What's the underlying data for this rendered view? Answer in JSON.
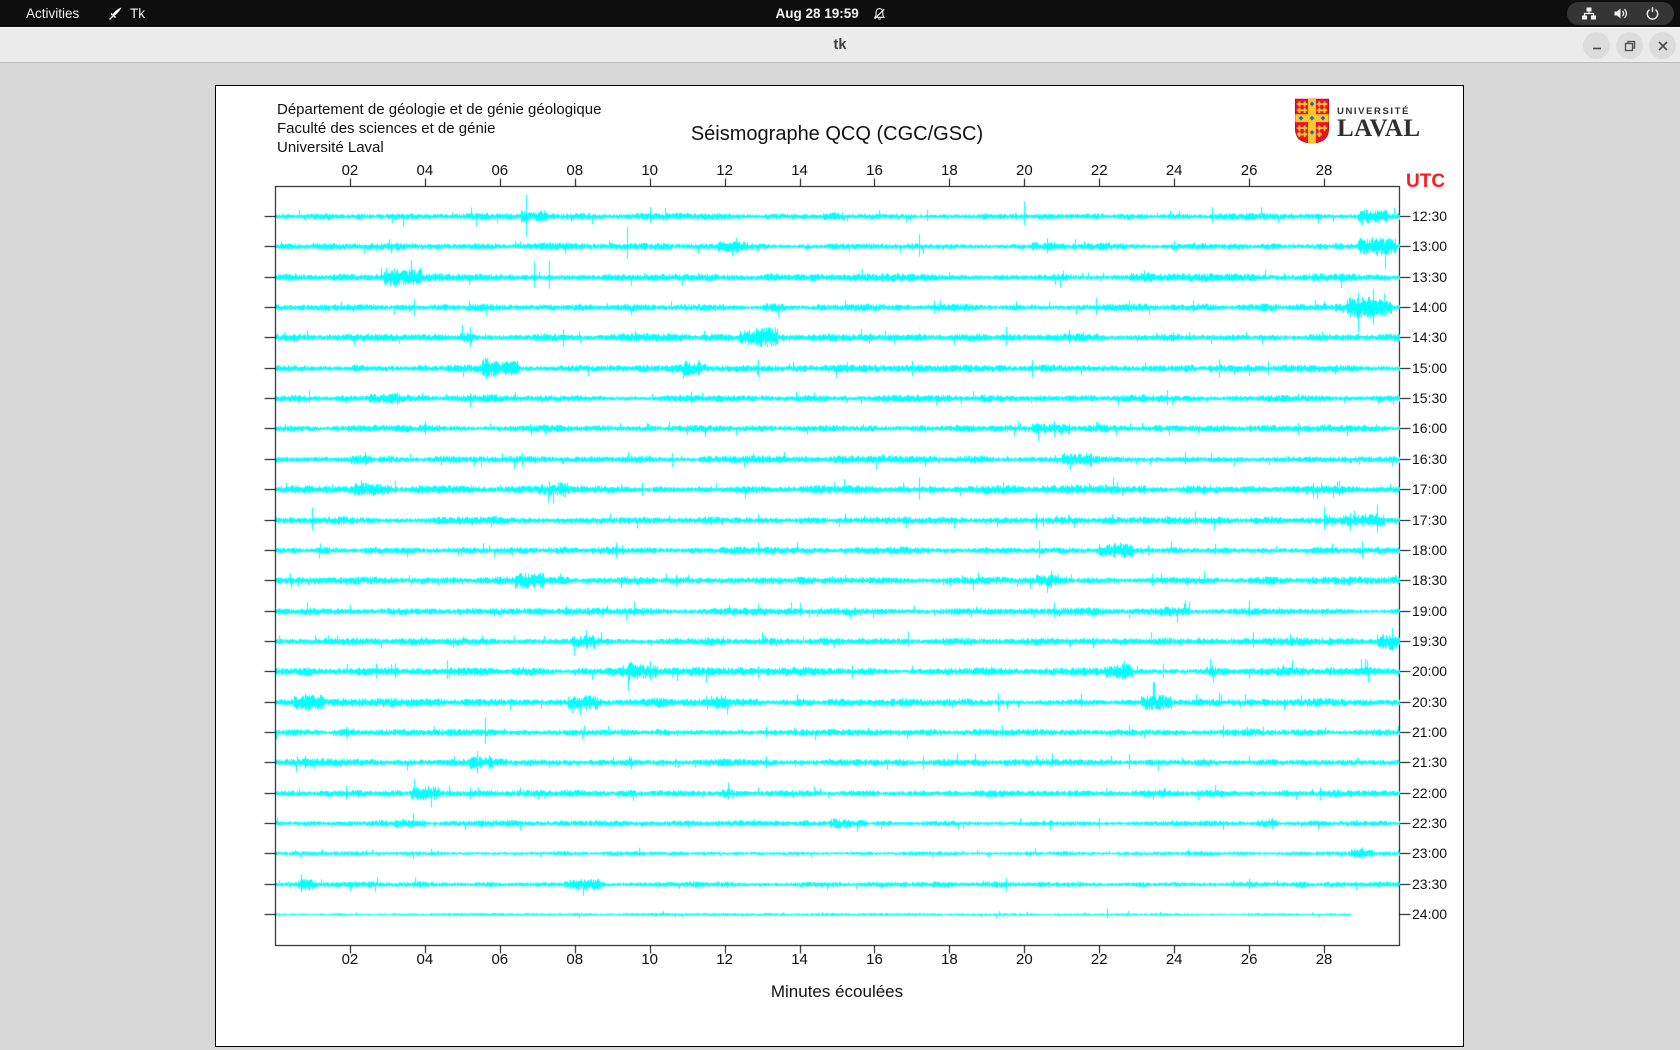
{
  "topbar": {
    "activities": "Activities",
    "app_name": "Tk",
    "clock": "Aug 28 19:59"
  },
  "titlebar": {
    "title": "tk"
  },
  "header": {
    "line1": "Département de géologie et de génie géologique",
    "line2": "Faculté des sciences et de génie",
    "line3": "Université Laval"
  },
  "logo": {
    "univ": "UNIVERSITÉ",
    "laval": "LAVAL"
  },
  "colors": {
    "trace": "#00ffff",
    "utc_red": "#fb1d1d",
    "axis_black": "#000000",
    "logo_red": "#e8112d",
    "logo_gold": "#ffc72c",
    "logo_blue": "#1a6fb5"
  },
  "chart_data": {
    "type": "line",
    "subtype": "seismograph-helicorder",
    "title": "Séismographe QCQ (CGC/GSC)",
    "xlabel": "Minutes écoulées",
    "right_axis_title": "UTC",
    "x_range_minutes": [
      0,
      30
    ],
    "x_ticks": [
      "02",
      "04",
      "06",
      "08",
      "10",
      "12",
      "14",
      "16",
      "18",
      "20",
      "22",
      "24",
      "26",
      "28"
    ],
    "grid": false,
    "legend": false,
    "rows": [
      {
        "label": "12:30",
        "amp": 2.2,
        "end": 30,
        "spikes": [
          [
            6.7,
            20
          ],
          [
            10.0,
            9
          ],
          [
            10.4,
            7
          ],
          [
            17.4,
            6
          ],
          [
            20.0,
            13
          ],
          [
            25.0,
            8
          ]
        ],
        "bursts": [
          [
            6.9,
            0.35,
            2.2
          ],
          [
            14.9,
            0.3,
            1.8
          ],
          [
            29.3,
            0.4,
            2.5
          ]
        ]
      },
      {
        "label": "13:00",
        "amp": 2.2,
        "end": 30,
        "spikes": [
          [
            9.4,
            16
          ],
          [
            12.3,
            8
          ],
          [
            17.2,
            11
          ],
          [
            20.6,
            7
          ],
          [
            24.0,
            6
          ]
        ],
        "bursts": [
          [
            12.2,
            0.4,
            1.8
          ],
          [
            20.5,
            0.3,
            1.8
          ],
          [
            29.4,
            0.5,
            3.0
          ]
        ]
      },
      {
        "label": "13:30",
        "amp": 2.4,
        "end": 30,
        "spikes": [
          [
            3.5,
            7
          ],
          [
            6.9,
            15
          ],
          [
            7.3,
            13
          ],
          [
            23.2,
            6
          ]
        ],
        "bursts": [
          [
            3.4,
            0.5,
            2.5
          ],
          [
            23.1,
            0.3,
            1.6
          ]
        ]
      },
      {
        "label": "14:00",
        "amp": 2.2,
        "end": 30,
        "spikes": [
          [
            3.7,
            9
          ],
          [
            17.6,
            8
          ],
          [
            21.9,
            9
          ],
          [
            24.5,
            6
          ],
          [
            28.9,
            18
          ],
          [
            29.3,
            22
          ],
          [
            29.6,
            16
          ]
        ],
        "bursts": [
          [
            13.3,
            0.3,
            1.6
          ],
          [
            29.2,
            0.6,
            3.0
          ]
        ]
      },
      {
        "label": "14:30",
        "amp": 2.4,
        "end": 30,
        "spikes": [
          [
            5.2,
            11
          ],
          [
            7.7,
            10
          ],
          [
            12.6,
            6
          ],
          [
            13.0,
            7
          ],
          [
            19.5,
            9
          ],
          [
            21.2,
            8
          ],
          [
            24.4,
            7
          ]
        ],
        "bursts": [
          [
            5.1,
            0.2,
            1.8
          ],
          [
            12.9,
            0.5,
            2.4
          ]
        ]
      },
      {
        "label": "15:00",
        "amp": 2.4,
        "end": 30,
        "spikes": [
          [
            11.3,
            8
          ],
          [
            12.9,
            9
          ],
          [
            17.0,
            8
          ],
          [
            20.2,
            10
          ],
          [
            25.2,
            9
          ],
          [
            26.5,
            7
          ]
        ],
        "bursts": [
          [
            6.0,
            0.5,
            2.6
          ],
          [
            11.2,
            0.3,
            1.8
          ]
        ]
      },
      {
        "label": "15:30",
        "amp": 2.2,
        "end": 30,
        "spikes": [
          [
            0.9,
            7
          ],
          [
            3.3,
            5
          ],
          [
            11.1,
            8
          ],
          [
            23.8,
            8
          ]
        ],
        "bursts": [
          [
            2.9,
            0.4,
            1.8
          ]
        ]
      },
      {
        "label": "16:00",
        "amp": 2.3,
        "end": 30,
        "spikes": [
          [
            4.0,
            8
          ],
          [
            20.8,
            9
          ],
          [
            27.3,
            7
          ]
        ],
        "bursts": [
          [
            4.1,
            0.3,
            1.8
          ],
          [
            20.7,
            0.5,
            2.4
          ]
        ]
      },
      {
        "label": "16:30",
        "amp": 2.3,
        "end": 30,
        "spikes": [
          [
            2.4,
            6
          ],
          [
            6.6,
            7
          ],
          [
            10.6,
            8
          ],
          [
            24.3,
            8
          ]
        ],
        "bursts": [
          [
            2.3,
            0.3,
            1.7
          ],
          [
            21.4,
            0.4,
            2.0
          ]
        ]
      },
      {
        "label": "17:00",
        "amp": 2.5,
        "end": 30,
        "spikes": [
          [
            2.3,
            8
          ],
          [
            3.2,
            7
          ],
          [
            7.3,
            9
          ],
          [
            7.6,
            8
          ],
          [
            9.8,
            7
          ],
          [
            17.2,
            10
          ],
          [
            27.7,
            8
          ],
          [
            28.4,
            7
          ]
        ],
        "bursts": [
          [
            2.6,
            0.5,
            1.9
          ],
          [
            7.4,
            0.4,
            1.8
          ]
        ]
      },
      {
        "label": "17:30",
        "amp": 2.3,
        "end": 30,
        "spikes": [
          [
            1.0,
            17
          ],
          [
            20.3,
            9
          ],
          [
            28.0,
            12
          ],
          [
            28.7,
            10
          ],
          [
            29.4,
            14
          ]
        ],
        "bursts": [
          [
            28.8,
            0.8,
            2.4
          ]
        ]
      },
      {
        "label": "18:00",
        "amp": 2.3,
        "end": 30,
        "spikes": [
          [
            9.1,
            9
          ],
          [
            12.9,
            7
          ],
          [
            20.4,
            8
          ],
          [
            23.3,
            7
          ],
          [
            25.1,
            6
          ],
          [
            29.0,
            8
          ]
        ],
        "bursts": [
          [
            22.4,
            0.5,
            2.2
          ]
        ]
      },
      {
        "label": "18:30",
        "amp": 2.3,
        "end": 30,
        "spikes": [
          [
            6.9,
            8
          ],
          [
            10.7,
            7
          ],
          [
            20.7,
            8
          ],
          [
            23.4,
            6
          ]
        ],
        "bursts": [
          [
            6.8,
            0.4,
            2.2
          ],
          [
            20.6,
            0.3,
            1.8
          ]
        ]
      },
      {
        "label": "19:00",
        "amp": 2.3,
        "end": 30,
        "spikes": [
          [
            14.0,
            7
          ],
          [
            20.8,
            8
          ],
          [
            26.0,
            10
          ]
        ],
        "bursts": [
          [
            24.0,
            0.4,
            1.8
          ]
        ]
      },
      {
        "label": "19:30",
        "amp": 2.4,
        "end": 30,
        "spikes": [
          [
            8.3,
            9
          ],
          [
            16.9,
            8
          ],
          [
            26.1,
            9
          ],
          [
            29.8,
            12
          ]
        ],
        "bursts": [
          [
            8.2,
            0.3,
            1.8
          ],
          [
            29.7,
            0.3,
            2.2
          ]
        ]
      },
      {
        "label": "20:00",
        "amp": 2.6,
        "end": 30,
        "spikes": [
          [
            2.7,
            8
          ],
          [
            3.2,
            7
          ],
          [
            4.6,
            9
          ],
          [
            9.3,
            8
          ],
          [
            10.0,
            9
          ],
          [
            12.9,
            7
          ],
          [
            15.4,
            8
          ],
          [
            22.6,
            9
          ],
          [
            23.7,
            8
          ],
          [
            25.0,
            8
          ]
        ],
        "bursts": [
          [
            9.8,
            0.4,
            2.0
          ],
          [
            22.5,
            0.4,
            2.0
          ],
          [
            25.1,
            0.3,
            1.8
          ]
        ]
      },
      {
        "label": "20:30",
        "amp": 2.6,
        "end": 30,
        "spikes": [
          [
            0.8,
            9
          ],
          [
            8.3,
            9
          ],
          [
            11.9,
            8
          ],
          [
            19.3,
            9
          ],
          [
            21.5,
            8
          ],
          [
            23.6,
            7
          ],
          [
            25.2,
            8
          ]
        ],
        "bursts": [
          [
            0.9,
            0.4,
            2.2
          ],
          [
            8.2,
            0.4,
            2.0
          ],
          [
            11.8,
            0.3,
            1.8
          ],
          [
            23.5,
            0.4,
            2.0
          ]
        ]
      },
      {
        "label": "21:00",
        "amp": 2.2,
        "end": 30,
        "spikes": [
          [
            1.9,
            7
          ],
          [
            5.6,
            13
          ],
          [
            13.1,
            8
          ],
          [
            19.4,
            7
          ],
          [
            22.8,
            8
          ],
          [
            25.3,
            7
          ]
        ],
        "bursts": [
          [
            1.8,
            0.3,
            1.7
          ]
        ]
      },
      {
        "label": "21:30",
        "amp": 2.3,
        "end": 30,
        "spikes": [
          [
            0.8,
            8
          ],
          [
            5.4,
            11
          ],
          [
            5.7,
            9
          ],
          [
            9.5,
            7
          ],
          [
            13.1,
            8
          ],
          [
            17.3,
            9
          ],
          [
            22.8,
            8
          ]
        ],
        "bursts": [
          [
            5.5,
            0.3,
            1.8
          ]
        ]
      },
      {
        "label": "22:00",
        "amp": 2.2,
        "end": 30,
        "spikes": [
          [
            1.9,
            7
          ],
          [
            5.2,
            6
          ],
          [
            12.1,
            10
          ],
          [
            27.9,
            7
          ]
        ],
        "bursts": [
          [
            4.0,
            0.4,
            2.0
          ],
          [
            12.0,
            0.2,
            1.6
          ]
        ]
      },
      {
        "label": "22:30",
        "amp": 1.8,
        "end": 30,
        "spikes": [
          [
            22.0,
            6
          ],
          [
            26.6,
            6
          ]
        ],
        "bursts": [
          [
            3.6,
            0.4,
            2.0
          ],
          [
            15.3,
            0.5,
            2.2
          ],
          [
            26.5,
            0.3,
            1.8
          ]
        ]
      },
      {
        "label": "23:00",
        "amp": 1.4,
        "end": 30,
        "spikes": [
          [
            29.0,
            5
          ]
        ],
        "bursts": [
          [
            29.0,
            0.3,
            1.8
          ]
        ]
      },
      {
        "label": "23:30",
        "amp": 1.8,
        "end": 30,
        "spikes": [
          [
            0.7,
            10
          ],
          [
            19.5,
            8
          ],
          [
            26.0,
            7
          ]
        ],
        "bursts": [
          [
            0.8,
            0.2,
            1.8
          ],
          [
            8.2,
            0.5,
            2.2
          ]
        ]
      },
      {
        "label": "24:00",
        "amp": 0.9,
        "end": 28.7,
        "spikes": [
          [
            22.2,
            5
          ]
        ],
        "bursts": []
      }
    ]
  }
}
